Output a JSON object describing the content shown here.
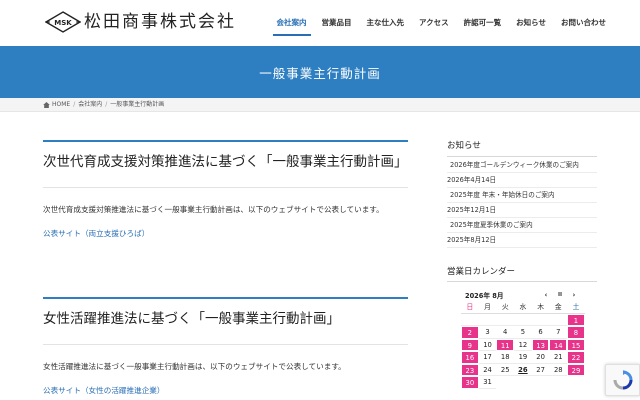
{
  "header": {
    "logo_mark": "MSK",
    "logo_text": "松田商事株式会社",
    "nav": [
      {
        "label": "会社案内",
        "active": true
      },
      {
        "label": "営業品目",
        "active": false
      },
      {
        "label": "主な仕入先",
        "active": false
      },
      {
        "label": "アクセス",
        "active": false
      },
      {
        "label": "許認可一覧",
        "active": false
      },
      {
        "label": "お知らせ",
        "active": false
      },
      {
        "label": "お問い合わせ",
        "active": false
      }
    ]
  },
  "banner": {
    "title": "一般事業主行動計画"
  },
  "breadcrumb": {
    "home": "HOME",
    "parent": "会社案内",
    "current": "一般事業主行動計画"
  },
  "sections": [
    {
      "title": "次世代育成支援対策推進法に基づく「一般事業主行動計画」",
      "text": "次世代育成支援対策推進法に基づく一般事業主行動計画は、以下のウェブサイトで公表しています。",
      "link": "公表サイト（両立支援ひろば）"
    },
    {
      "title": "女性活躍推進法に基づく「一般事業主行動計画」",
      "text": "女性活躍推進法に基づく一般事業主行動計画は、以下のウェブサイトで公表しています。",
      "link": "公表サイト（女性の活躍推進企業）"
    }
  ],
  "sidebar": {
    "news_heading": "お知らせ",
    "news": [
      {
        "title": "2026年度ゴールデンウィーク休業のご案内",
        "date": "2026年4月14日"
      },
      {
        "title": "2025年度 年末・年始休日のご案内",
        "date": "2025年12月1日"
      },
      {
        "title": "2025年度夏季休業のご案内",
        "date": "2025年8月12日"
      }
    ],
    "calendar_heading": "営業日カレンダー",
    "calendar": {
      "month": "2026年 8月",
      "prev": "‹",
      "pause": "II",
      "next": "›",
      "weekdays": [
        "日",
        "月",
        "火",
        "水",
        "木",
        "金",
        "土"
      ],
      "days": [
        {
          "d": ""
        },
        {
          "d": ""
        },
        {
          "d": ""
        },
        {
          "d": ""
        },
        {
          "d": ""
        },
        {
          "d": ""
        },
        {
          "d": "1",
          "hol": true
        },
        {
          "d": "2",
          "hol": true
        },
        {
          "d": "3"
        },
        {
          "d": "4"
        },
        {
          "d": "5"
        },
        {
          "d": "6"
        },
        {
          "d": "7"
        },
        {
          "d": "8",
          "hol": true
        },
        {
          "d": "9",
          "hol": true
        },
        {
          "d": "10"
        },
        {
          "d": "11",
          "hol": true
        },
        {
          "d": "12"
        },
        {
          "d": "13",
          "hol": true
        },
        {
          "d": "14",
          "hol": true
        },
        {
          "d": "15",
          "hol": true
        },
        {
          "d": "16",
          "hol": true
        },
        {
          "d": "17"
        },
        {
          "d": "18"
        },
        {
          "d": "19"
        },
        {
          "d": "20"
        },
        {
          "d": "21"
        },
        {
          "d": "22",
          "hol": true
        },
        {
          "d": "23",
          "hol": true
        },
        {
          "d": "24"
        },
        {
          "d": "25"
        },
        {
          "d": "26",
          "today": true
        },
        {
          "d": "27"
        },
        {
          "d": "28"
        },
        {
          "d": "29",
          "hol": true
        },
        {
          "d": "30",
          "hol": true
        },
        {
          "d": "31"
        }
      ]
    }
  },
  "colors": {
    "accent": "#2e7fc1",
    "holiday": "#e8338a",
    "saturday": "#2a6fb5"
  }
}
